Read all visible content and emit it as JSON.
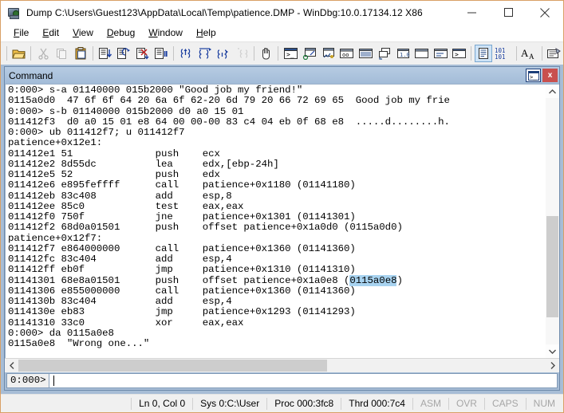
{
  "window": {
    "title": "Dump C:\\Users\\Guest123\\AppData\\Local\\Temp\\patience.DMP - WinDbg:10.0.17134.12 X86",
    "minimize_label": "—",
    "maximize_label": "☐",
    "close_label": "✕",
    "app_icon": "windbg-icon"
  },
  "menu": {
    "items": [
      {
        "label": "File",
        "accel": "F",
        "rest": "ile"
      },
      {
        "label": "Edit",
        "accel": "E",
        "rest": "dit"
      },
      {
        "label": "View",
        "accel": "V",
        "rest": "iew"
      },
      {
        "label": "Debug",
        "accel": "D",
        "rest": "ebug"
      },
      {
        "label": "Window",
        "accel": "W",
        "rest": "indow"
      },
      {
        "label": "Help",
        "accel": "H",
        "rest": "elp"
      }
    ]
  },
  "toolbar": {
    "buttons": [
      {
        "name": "open-file-icon",
        "enabled": true
      },
      {
        "name": "cut-icon",
        "enabled": false
      },
      {
        "name": "copy-icon",
        "enabled": false
      },
      {
        "name": "paste-icon",
        "enabled": true
      },
      {
        "name": "step-into-icon",
        "enabled": true
      },
      {
        "name": "step-over-icon",
        "enabled": true
      },
      {
        "name": "run-to-cursor-icon",
        "enabled": true
      },
      {
        "name": "break-icon",
        "enabled": true
      },
      {
        "name": "trace-into-func-icon",
        "enabled": true
      },
      {
        "name": "step-out-func-icon",
        "enabled": true
      },
      {
        "name": "step-over-func-icon",
        "enabled": true
      },
      {
        "name": "restart-func-icon",
        "enabled": false
      },
      {
        "name": "hand-break-icon",
        "enabled": true
      },
      {
        "name": "command-window-icon",
        "enabled": true
      },
      {
        "name": "watch-window-icon",
        "enabled": true
      },
      {
        "name": "locals-window-icon",
        "enabled": true
      },
      {
        "name": "registers-window-icon",
        "enabled": true
      },
      {
        "name": "memory-window-icon",
        "enabled": true
      },
      {
        "name": "calls-window-icon",
        "enabled": true
      },
      {
        "name": "disassembly-window-icon",
        "enabled": true
      },
      {
        "name": "scratch-pad-icon",
        "enabled": true
      },
      {
        "name": "processes-threads-icon",
        "enabled": true
      },
      {
        "name": "command-browser-icon",
        "enabled": true
      },
      {
        "name": "source-mode-icon",
        "enabled": true,
        "selected": true
      },
      {
        "name": "assembly-mode-icon",
        "enabled": true
      },
      {
        "name": "font-icon",
        "enabled": true
      },
      {
        "name": "options-icon",
        "enabled": true
      }
    ]
  },
  "command_window": {
    "caption": "Command",
    "restore_icon": "restore-window-icon",
    "close_icon": "close-window-icon",
    "output": [
      "0:000> s-a 01140000 015b2000 \"Good job my friend!\"",
      "0115a0d0  47 6f 6f 64 20 6a 6f 62-20 6d 79 20 66 72 69 65  Good job my frie",
      "0:000> s-b 01140000 015b2000 d0 a0 15 01",
      "011412f3  d0 a0 15 01 e8 64 00 00-00 83 c4 04 eb 0f 68 e8  .....d........h.",
      "0:000> ub 011412f7; u 011412f7",
      "patience+0x12e1:",
      "011412e1 51              push    ecx",
      "011412e2 8d55dc          lea     edx,[ebp-24h]",
      "011412e5 52              push    edx",
      "011412e6 e895feffff      call    patience+0x1180 (01141180)",
      "011412eb 83c408          add     esp,8",
      "011412ee 85c0            test    eax,eax",
      "011412f0 750f            jne     patience+0x1301 (01141301)",
      "011412f2 68d0a01501      push    offset patience+0x1a0d0 (0115a0d0)",
      "patience+0x12f7:",
      "011412f7 e864000000      call    patience+0x1360 (01141360)",
      "011412fc 83c404          add     esp,4",
      "011412ff eb0f            jmp     patience+0x1310 (01141310)",
      "01141301 68e8a01501      push    offset patience+0x1a0e8 (",
      "01141306 e855000000      call    patience+0x1360 (01141360)",
      "0114130b 83c404          add     esp,4",
      "0114130e eb83            jmp     patience+0x1293 (01141293)",
      "01141310 33c0            xor     eax,eax",
      "0:000> da 0115a0e8",
      "0115a0e8  \"Wrong one...\""
    ],
    "highlight": {
      "line_index": 18,
      "text": "0115a0e8",
      "suffix": ")",
      "color": "#a8d3f0"
    },
    "prompt_label": "0:000>",
    "prompt_value": "",
    "scroll_up_icon": "chevron-up-icon",
    "scroll_down_icon": "chevron-down-icon",
    "scroll_left_icon": "chevron-left-icon",
    "scroll_right_icon": "chevron-right-icon"
  },
  "statusbar": {
    "cells": [
      {
        "label": "Ln 0, Col 0",
        "dim": false
      },
      {
        "label": "Sys 0:C:\\User",
        "dim": false
      },
      {
        "label": "Proc 000:3fc8",
        "dim": false
      },
      {
        "label": "Thrd 000:7c4",
        "dim": false
      },
      {
        "label": "ASM",
        "dim": true
      },
      {
        "label": "OVR",
        "dim": true
      },
      {
        "label": "CAPS",
        "dim": true
      },
      {
        "label": "NUM",
        "dim": true
      }
    ]
  },
  "colors": {
    "mdi_background": "#a7bdd6",
    "caption_gradient_top": "#b6cbe2",
    "close_button": "#c9504e",
    "selection": "#a8d3f0",
    "window_border": "#d9a066"
  }
}
